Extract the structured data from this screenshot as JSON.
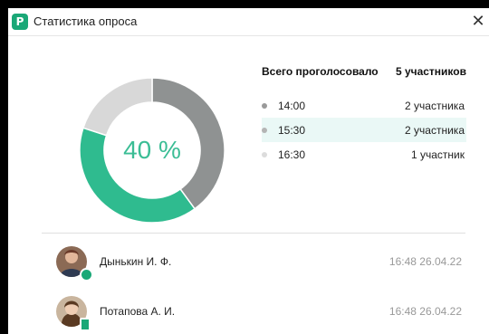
{
  "window": {
    "title": "Статистика опроса",
    "app_icon_letter": "P",
    "close_glyph": "✕"
  },
  "donut": {
    "center_label": "40 %",
    "segments": [
      {
        "label": "14:00",
        "fraction": 0.4,
        "color": "#8f9292"
      },
      {
        "label": "15:30",
        "fraction": 0.4,
        "color": "#2fbb8f"
      },
      {
        "label": "16:30",
        "fraction": 0.2,
        "color": "#d8d8d8"
      }
    ]
  },
  "stats": {
    "total_label": "Всего проголосовало",
    "total_value": "5 участников",
    "options": [
      {
        "time": "14:00",
        "count": "2 участника",
        "dot_color": "#9a9a9a",
        "highlighted": false
      },
      {
        "time": "15:30",
        "count": "2 участника",
        "dot_color": "#b4b4b4",
        "highlighted": true
      },
      {
        "time": "16:30",
        "count": "1 участник",
        "dot_color": "#dcdcdc",
        "highlighted": false
      }
    ]
  },
  "voters": [
    {
      "name": "Дынькин И. Ф.",
      "time": "16:48 26.04.22",
      "avatar": "user-avatar-male-icon",
      "status": "online"
    },
    {
      "name": "Потапова  А. И.",
      "time": "16:48 26.04.22",
      "avatar": "user-avatar-female-icon",
      "status": "mobile"
    }
  ]
}
